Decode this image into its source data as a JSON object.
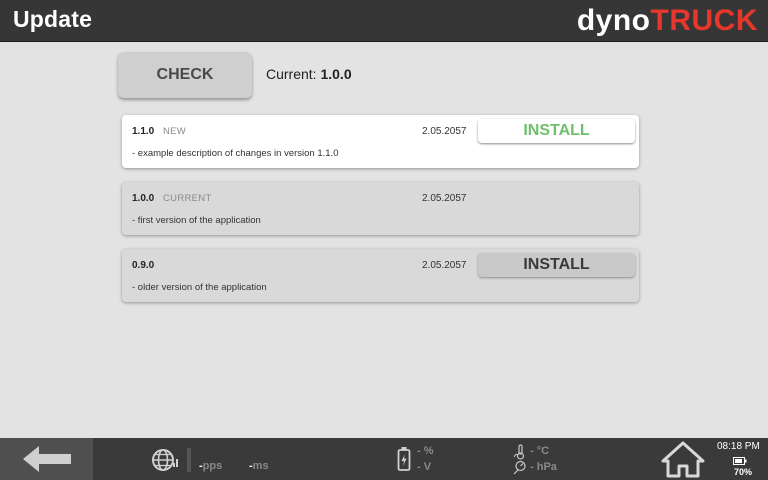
{
  "header": {
    "title": "Update",
    "logo_part1": "dyno",
    "logo_part2": "TRUCK"
  },
  "check": {
    "button_label": "CHECK",
    "current_label": "Current:",
    "current_version": "1.0.0"
  },
  "versions": [
    {
      "version": "1.1.0",
      "tag": "NEW",
      "date": "2.05.2057",
      "description": "- example description of changes in version 1.1.0",
      "install_label": "INSTALL"
    },
    {
      "version": "1.0.0",
      "tag": "CURRENT",
      "date": "2.05.2057",
      "description": "- first version of the application",
      "install_label": ""
    },
    {
      "version": "0.9.0",
      "tag": "",
      "date": "2.05.2057",
      "description": "- older version of the application",
      "install_label": "INSTALL"
    }
  ],
  "footer": {
    "pps_value": "-",
    "pps_unit": "pps",
    "ms_value": "-",
    "ms_unit": "ms",
    "percent_value": "-",
    "percent_unit": "%",
    "volt_value": "-",
    "volt_unit": "V",
    "temp_value": "-",
    "temp_unit": "°C",
    "pressure_value": "-",
    "pressure_unit": "hPa",
    "time": "08:18 PM",
    "battery": "70%"
  },
  "colors": {
    "header_bg": "#363636",
    "logo_accent": "#e5372c",
    "install_active": "#6cc06c",
    "page_bg": "#e3e3e3"
  },
  "icons": [
    "arrow-left-icon",
    "globe-icon",
    "battery-icon",
    "thermometer-icon",
    "barometer-icon",
    "home-icon"
  ]
}
